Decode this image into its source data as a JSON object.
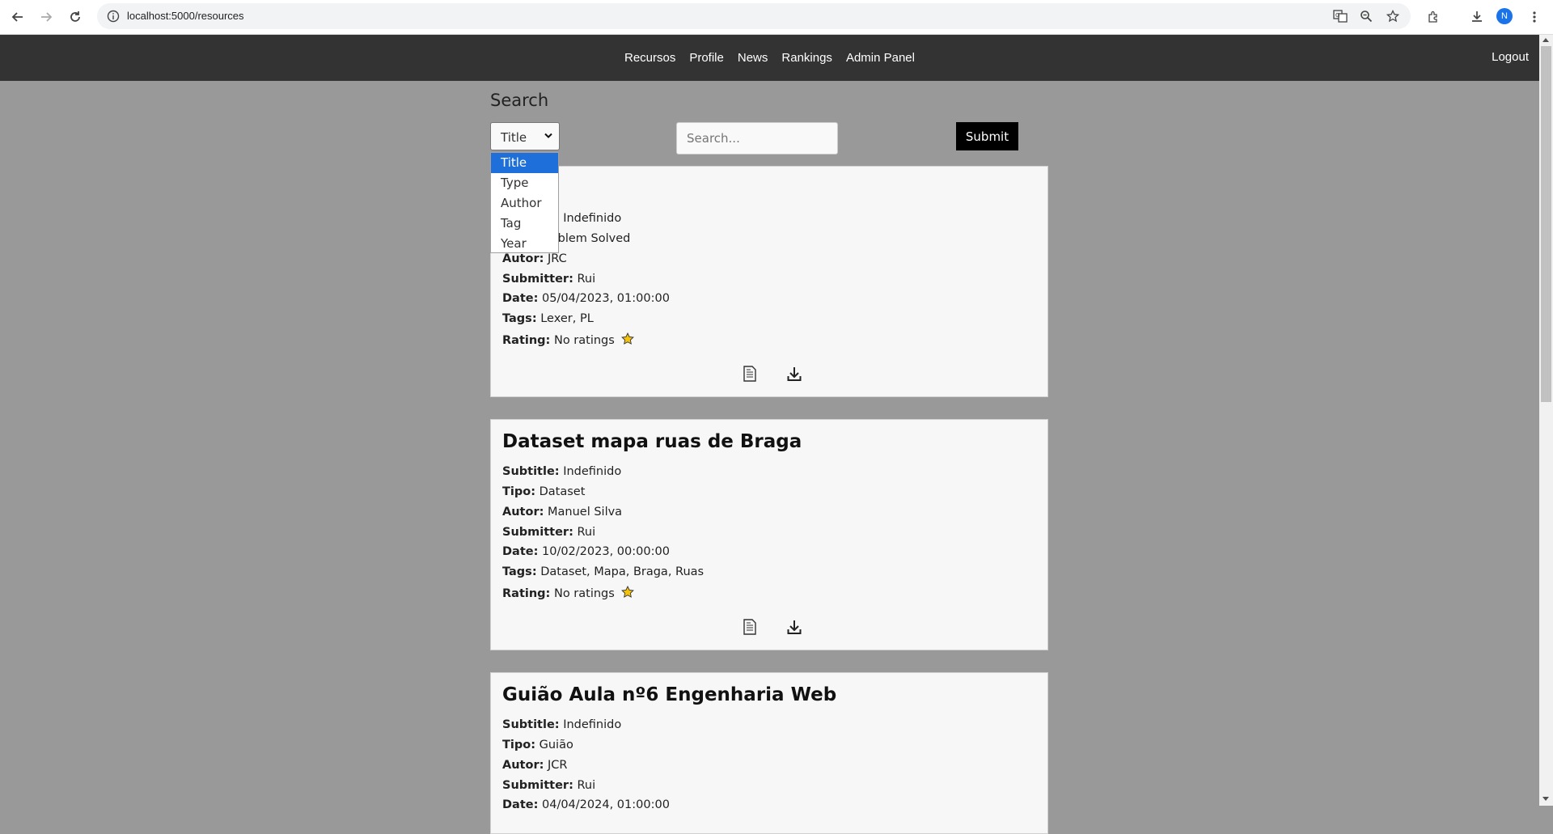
{
  "browser": {
    "url": "localhost:5000/resources",
    "avatar_letter": "N"
  },
  "nav": {
    "links": [
      "Recursos",
      "Profile",
      "News",
      "Rankings",
      "Admin Panel"
    ],
    "logout": "Logout"
  },
  "search": {
    "heading": "Search",
    "selected": "Title",
    "options": [
      "Title",
      "Type",
      "Author",
      "Tag",
      "Year"
    ],
    "placeholder": "Search...",
    "submit_label": "Submit"
  },
  "labels": {
    "subtitle": "Subtitle:",
    "tipo": "Tipo:",
    "autor": "Autor:",
    "submitter": "Submitter:",
    "date": "Date:",
    "tags": "Tags:",
    "rating": "Rating:"
  },
  "resources": [
    {
      "title": "",
      "subtitle": "Indefinido",
      "tipo": "Problem Solved",
      "autor": "JRC",
      "submitter": "Rui",
      "date": "05/04/2023, 01:00:00",
      "tags": "Lexer, PL",
      "rating": "No ratings"
    },
    {
      "title": "Dataset mapa ruas de Braga",
      "subtitle": "Indefinido",
      "tipo": "Dataset",
      "autor": "Manuel Silva",
      "submitter": "Rui",
      "date": "10/02/2023, 00:00:00",
      "tags": "Dataset, Mapa, Braga, Ruas",
      "rating": "No ratings"
    },
    {
      "title": "Guião Aula nº6 Engenharia Web",
      "subtitle": "Indefinido",
      "tipo": "Guião",
      "autor": "JCR",
      "submitter": "Rui",
      "date": "04/04/2024, 01:00:00",
      "tags": "",
      "rating": ""
    }
  ],
  "colors": {
    "nav_bg": "#333333",
    "page_bg": "#999999",
    "card_bg": "#f7f7f7",
    "selected_option": "#1e6fd9",
    "star": "#f4c20d"
  }
}
